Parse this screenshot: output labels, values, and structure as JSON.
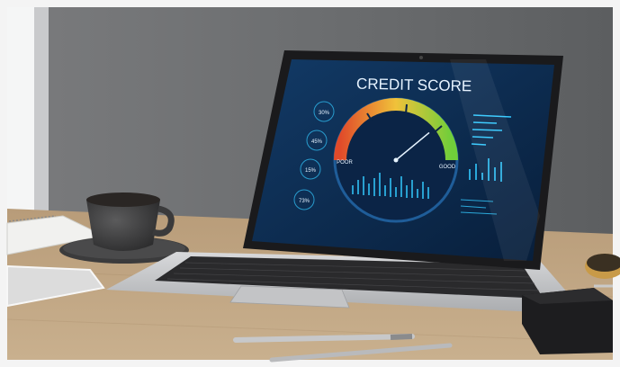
{
  "screen": {
    "title": "CREDIT SCORE",
    "gauge_labels": {
      "low": "POOR",
      "high": "GOOD"
    },
    "side_percentages": [
      "30%",
      "45%",
      "15%",
      "73%"
    ],
    "gauge_needle_fraction": 0.78
  },
  "colors": {
    "screen_bg": "#0c2a4d",
    "accent_cyan": "#33c9ff",
    "gauge_red": "#e04a2a",
    "gauge_yellow": "#f0c23a",
    "gauge_green": "#6fce3a"
  }
}
